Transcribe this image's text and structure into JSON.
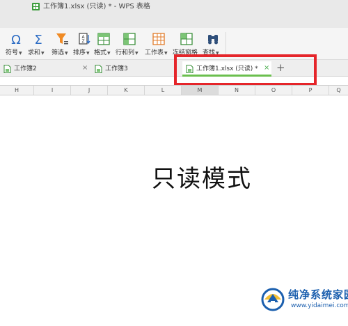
{
  "window": {
    "title": "工作簿1.xlsx (只读) * - WPS 表格"
  },
  "ribbon": {
    "buttons": [
      {
        "id": "symbol",
        "label": "符号",
        "icon": "omega-icon"
      },
      {
        "id": "sum",
        "label": "求和",
        "icon": "sigma-icon"
      },
      {
        "id": "filter",
        "label": "筛选",
        "icon": "filter-icon"
      },
      {
        "id": "sort",
        "label": "排序",
        "icon": "sort-icon"
      },
      {
        "id": "format",
        "label": "格式",
        "icon": "format-icon"
      },
      {
        "id": "rowcol",
        "label": "行和列",
        "icon": "row-col-icon"
      },
      {
        "id": "sheet",
        "label": "工作表",
        "icon": "worksheet-icon"
      },
      {
        "id": "freeze",
        "label": "冻结窗格",
        "icon": "freeze-pane-icon"
      },
      {
        "id": "find",
        "label": "查找",
        "icon": "binoculars-icon"
      }
    ]
  },
  "tabs": [
    {
      "label": "工作簿2",
      "active": false
    },
    {
      "label": "工作簿3",
      "active": false
    },
    {
      "label": "工作簿1.xlsx (只读) *",
      "active": true
    }
  ],
  "tab_close_symbol": "×",
  "add_tab_symbol": "+",
  "columns": [
    "H",
    "I",
    "J",
    "K",
    "L",
    "M",
    "N",
    "O",
    "P",
    "Q"
  ],
  "selected_column": "M",
  "sheet": {
    "center_text": "只读模式"
  },
  "watermark": {
    "title": "纯净系统家园",
    "url": "www.yidaimei.com"
  },
  "colors": {
    "highlight": "#e5252a",
    "active_tab_accent": "#6bbf4e",
    "watermark": "#1b5fae"
  }
}
